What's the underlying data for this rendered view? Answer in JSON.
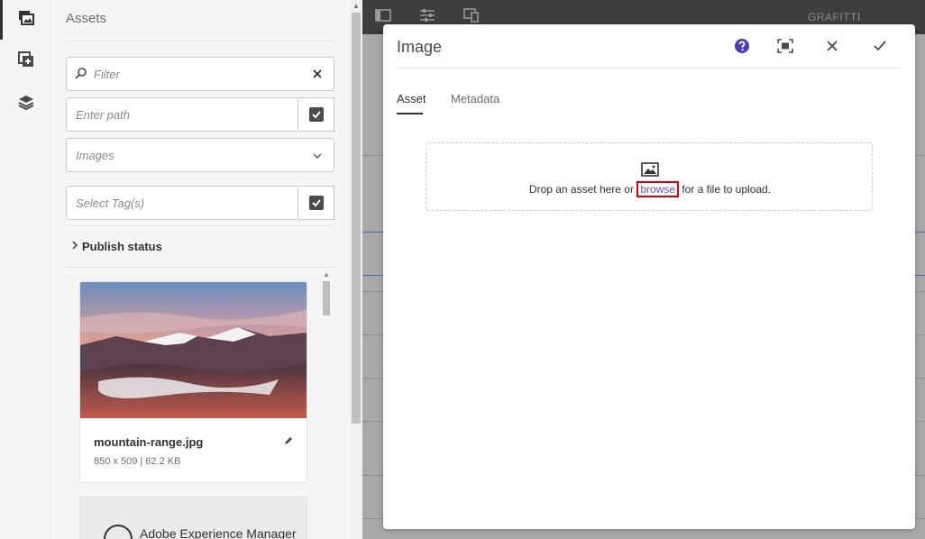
{
  "side_rail": {
    "items": [
      {
        "name": "assets",
        "icon": "assets-icon"
      },
      {
        "name": "components",
        "icon": "components-icon"
      },
      {
        "name": "content-tree",
        "icon": "layers-icon"
      }
    ]
  },
  "assets_panel": {
    "title": "Assets",
    "filter": {
      "placeholder": "Filter"
    },
    "path": {
      "placeholder": "Enter path"
    },
    "type_select": {
      "value": "Images"
    },
    "tags": {
      "placeholder": "Select Tag(s)"
    },
    "publish_status_label": "Publish status",
    "assets": [
      {
        "name": "mountain-range.jpg",
        "meta": "850 x 509 | 62.2 KB"
      },
      {
        "name": "Adobe Experience Manager"
      }
    ]
  },
  "editor": {
    "brand_text": "GRAFITTI"
  },
  "dialog": {
    "title": "Image",
    "tabs": [
      "Asset",
      "Metadata"
    ],
    "drop": {
      "text_before": "Drop an asset here or ",
      "browse": "browse",
      "text_after": " for a file to upload."
    }
  },
  "colors": {
    "help": "#4b3bbf",
    "browse_link": "#6d4fc7",
    "highlight": "#e00000"
  }
}
